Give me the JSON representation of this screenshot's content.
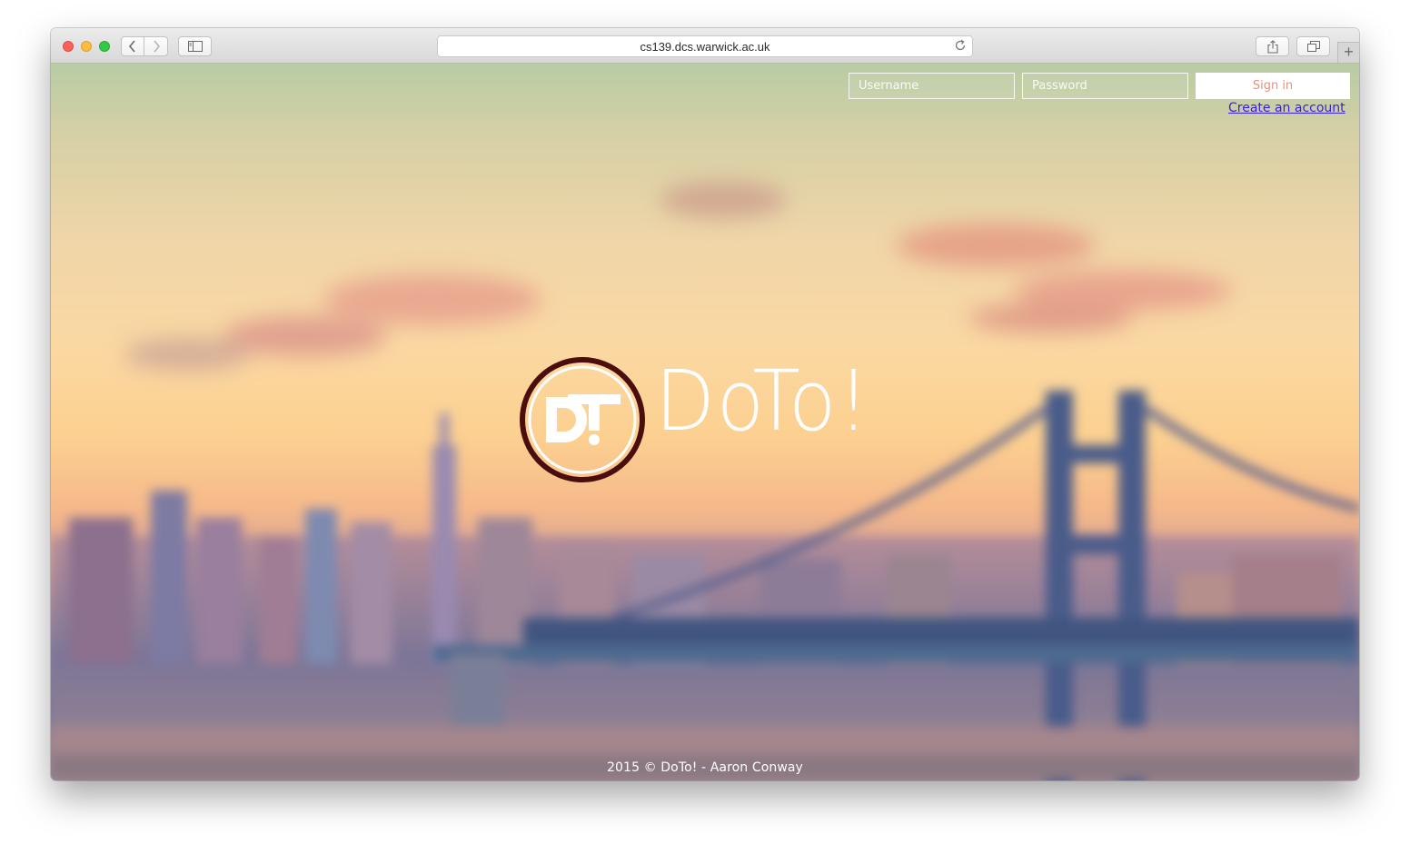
{
  "browser": {
    "address": "cs139.dcs.warwick.ac.uk",
    "new_tab_label": "+"
  },
  "login": {
    "username_placeholder": "Username",
    "password_placeholder": "Password",
    "signin_label": "Sign in",
    "create_account_label": "Create an account"
  },
  "brand": {
    "logo_mark": "DT!",
    "title": "DoTo!"
  },
  "footer": {
    "text": "2015 © DoTo! - Aaron Conway"
  },
  "colors": {
    "accent": "#e8917c",
    "link": "#3a1ee0",
    "logo_ring": "#4a0e0e"
  }
}
